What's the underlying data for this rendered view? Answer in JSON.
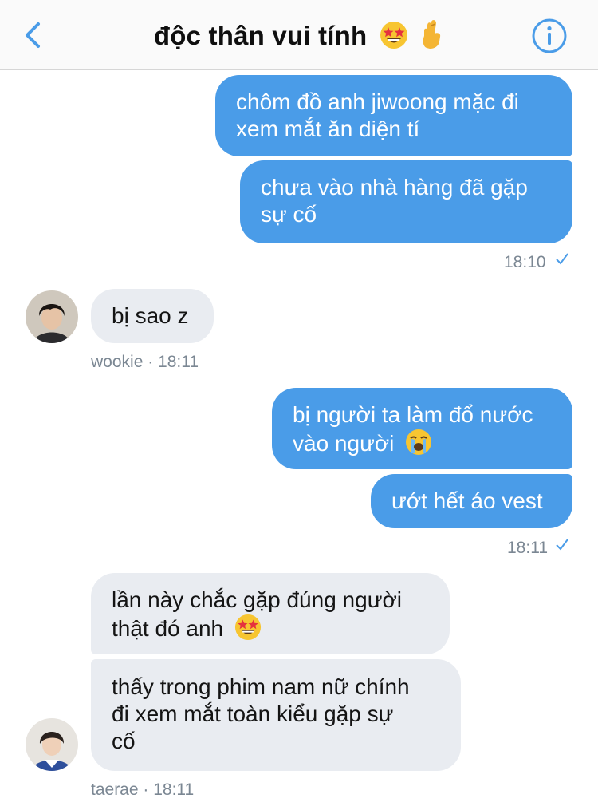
{
  "header": {
    "title": "độc thân vui tính",
    "title_emojis": [
      "star-struck-face-icon",
      "crossed-fingers-icon"
    ],
    "back_icon": "chevron-left-icon",
    "info_icon": "info-circle-icon",
    "accent_color": "#4a9ce8"
  },
  "messages": [
    {
      "direction": "outgoing",
      "lines": [
        "chôm đồ anh jiwoong mặc đi",
        "xem mắt ăn diện tí"
      ]
    },
    {
      "direction": "outgoing",
      "lines": [
        "chưa vào nhà hàng đã gặp",
        "sự cố"
      ]
    },
    {
      "direction": "outgoing_meta",
      "time": "18:10",
      "status_icon": "check-icon"
    },
    {
      "direction": "incoming",
      "sender": "wookie",
      "lines": [
        "bị sao z"
      ]
    },
    {
      "direction": "incoming_meta",
      "label": "wookie · 18:11"
    },
    {
      "direction": "outgoing",
      "lines": [
        "bị người ta làm đổ nước",
        "vào người"
      ],
      "emoji": "loudly-crying-face-icon"
    },
    {
      "direction": "outgoing",
      "lines": [
        "ướt hết áo vest"
      ]
    },
    {
      "direction": "outgoing_meta",
      "time": "18:11",
      "status_icon": "check-icon"
    },
    {
      "direction": "incoming",
      "sender": "taerae",
      "lines": [
        "lần này chắc gặp đúng người",
        "thật đó anh"
      ],
      "emoji": "star-struck-face-icon"
    },
    {
      "direction": "incoming",
      "sender": "taerae",
      "lines": [
        "thấy trong phim nam nữ chính",
        "đi xem mắt toàn kiểu gặp sự",
        "cố"
      ]
    },
    {
      "direction": "incoming_meta",
      "label": "taerae · 18:11"
    }
  ],
  "colors": {
    "outgoing_bubble": "#4a9ce8",
    "incoming_bubble": "#e9ecf1",
    "meta_text": "#7b8793"
  }
}
